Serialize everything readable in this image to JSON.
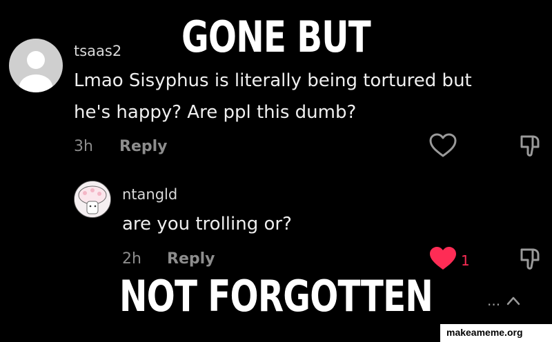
{
  "meme": {
    "top_text": "GONE BUT",
    "bottom_text": "NOT FORGOTTEN",
    "watermark": "makeameme.org"
  },
  "comments": [
    {
      "username": "tsaas2",
      "text_line1": "Lmao Sisyphus is literally being tortured but",
      "text_line2": "he's happy? Are ppl this dumb?",
      "time": "3h",
      "reply_label": "Reply",
      "avatar_icon": "default-user-icon",
      "liked": false
    },
    {
      "username": "ntangld",
      "text_line1": "are you trolling or?",
      "time": "2h",
      "reply_label": "Reply",
      "like_count": "1",
      "avatar_icon": "profile-picture",
      "liked": true
    }
  ],
  "more_replies_label": "...",
  "colors": {
    "background": "#000000",
    "like_red": "#fe2c55",
    "muted_text": "#8d8d8d"
  }
}
